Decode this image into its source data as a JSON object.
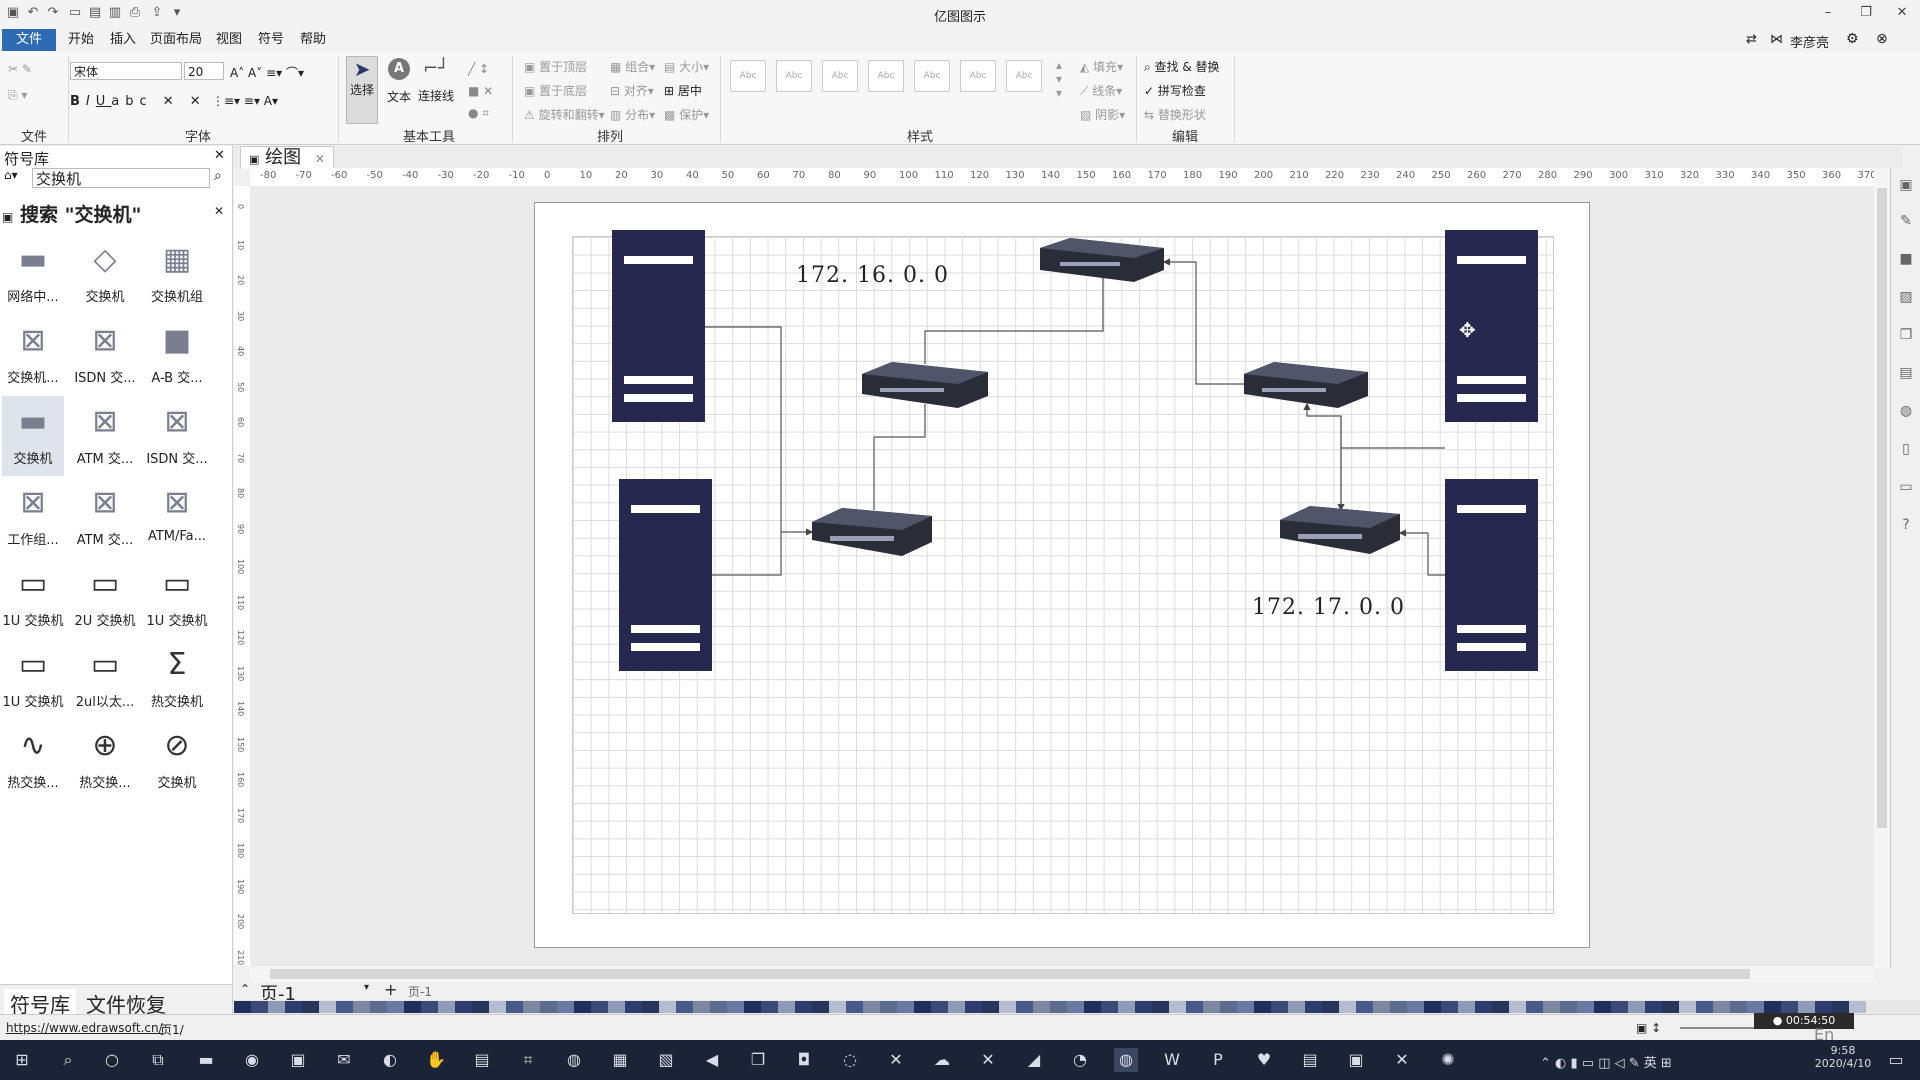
{
  "app": {
    "title": "亿图图示",
    "user": "李彦亮",
    "quick_access_icons": [
      "app-icon",
      "undo-icon",
      "redo-icon",
      "new-icon",
      "open-icon",
      "save-icon",
      "print-icon",
      "export-icon",
      "dropdown-icon"
    ]
  },
  "menu": [
    "文件",
    "开始",
    "插入",
    "页面布局",
    "视图",
    "符号",
    "帮助"
  ],
  "ribbon": {
    "groups": [
      "文件",
      "字体",
      "基本工具",
      "排列",
      "样式",
      "编辑"
    ],
    "font_name": "宋体",
    "font_size": "20",
    "tools": {
      "select": "选择",
      "text": "文本",
      "connector": "连接线"
    },
    "arrange": [
      "置于顶层",
      "组合",
      "大小",
      "置于底层",
      "对齐",
      "居中",
      "旋转和翻转",
      "分布",
      "保护"
    ],
    "style_box_label": "Abc",
    "style_options": [
      "填充",
      "线条",
      "阴影"
    ],
    "edit": [
      "查找 & 替换",
      "拼写检查",
      "替换形状"
    ]
  },
  "left_panel": {
    "title": "符号库",
    "search_value": "交换机",
    "search_header": "搜索 \"交换机\"",
    "symbols": [
      "网络中...",
      "交换机",
      "交换机组",
      "交换机...",
      "ISDN 交...",
      "A-B 交...",
      "交换机",
      "ATM 交...",
      "ISDN 交...",
      "工作组...",
      "ATM 交...",
      "ATM/Fa...",
      "1U 交换机",
      "2U 交换机",
      "1U 交换机",
      "1U 交换机",
      "2ul以太...",
      "热交换机",
      "热交换...",
      "热交换...",
      "交换机"
    ],
    "tabs": [
      "符号库",
      "文件恢复"
    ]
  },
  "canvas": {
    "tab_label": "绘图",
    "ruler_labels": [
      "-80",
      "-70",
      "-60",
      "-50",
      "-40",
      "-30",
      "-20",
      "-10",
      "0",
      "10",
      "20",
      "30",
      "40",
      "50",
      "60",
      "70",
      "80",
      "90",
      "100",
      "110",
      "120",
      "130",
      "140",
      "150",
      "160",
      "170",
      "180",
      "190",
      "200",
      "210",
      "220",
      "230",
      "240",
      "250",
      "260",
      "270",
      "280",
      "290",
      "300",
      "310",
      "320",
      "330",
      "340",
      "350",
      "360",
      "370"
    ],
    "vruler_labels": [
      "0",
      "10",
      "20",
      "30",
      "40",
      "50",
      "60",
      "70",
      "80",
      "90",
      "100",
      "110",
      "120",
      "130",
      "140",
      "150",
      "160",
      "170",
      "180",
      "190",
      "200",
      "210"
    ],
    "ip_label_1": "172. 16. 0. 0",
    "ip_label_2": "172. 17. 0. 0"
  },
  "pages": {
    "current": "页-1",
    "tab": "页-1",
    "add": "+"
  },
  "status": {
    "url": "https://www.edrawsoft.cn/",
    "page_info": "页1/",
    "rec_time": "00:54:50",
    "language": "En",
    "ime": "英"
  },
  "taskbar": {
    "time": "9:58",
    "date": "2020/4/10"
  },
  "colors": {
    "accent": "#2f6bb3",
    "server": "#27284f",
    "taskbar": "#1b2436"
  }
}
